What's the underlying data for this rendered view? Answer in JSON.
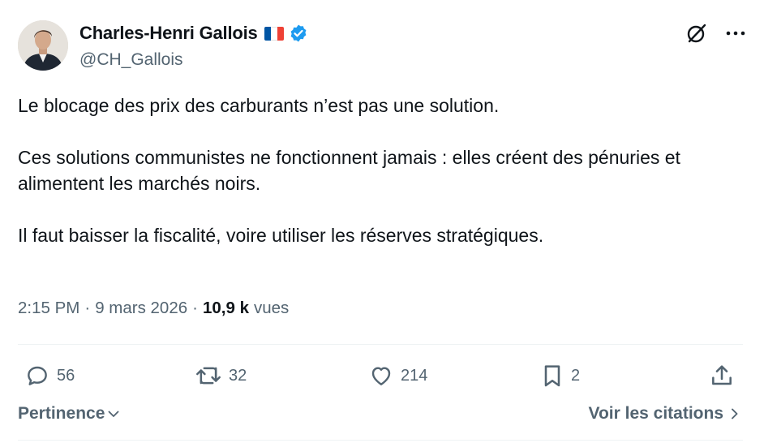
{
  "author": {
    "display_name": "Charles-Henri Gallois",
    "handle": "@CH_Gallois",
    "flag_icon": "france-flag-icon",
    "verified_icon": "verified-badge-icon",
    "verified_color": "#1d9bf0"
  },
  "tweet": {
    "paragraphs": [
      "Le blocage des prix des carburants n’est pas une solution.",
      "Ces solutions communistes ne fonctionnent jamais : elles créent des pénuries et alimentent les marchés noirs.",
      "Il faut baisser la fiscalité, voire utiliser les réserves stratégiques."
    ]
  },
  "meta": {
    "time": "2:15 PM",
    "separator": "·",
    "date": "9 mars 2026",
    "views_count": "10,9 k",
    "views_label": "vues"
  },
  "actions": {
    "replies": "56",
    "reposts": "32",
    "likes": "214",
    "bookmarks": "2"
  },
  "footer": {
    "sort_label": "Pertinence",
    "quotes_label": "Voir les citations"
  },
  "colors": {
    "text": "#0f1419",
    "secondary": "#536471",
    "divider": "#eff3f4",
    "flag_blue": "#0055a4",
    "flag_white": "#ffffff",
    "flag_red": "#ef4135"
  }
}
